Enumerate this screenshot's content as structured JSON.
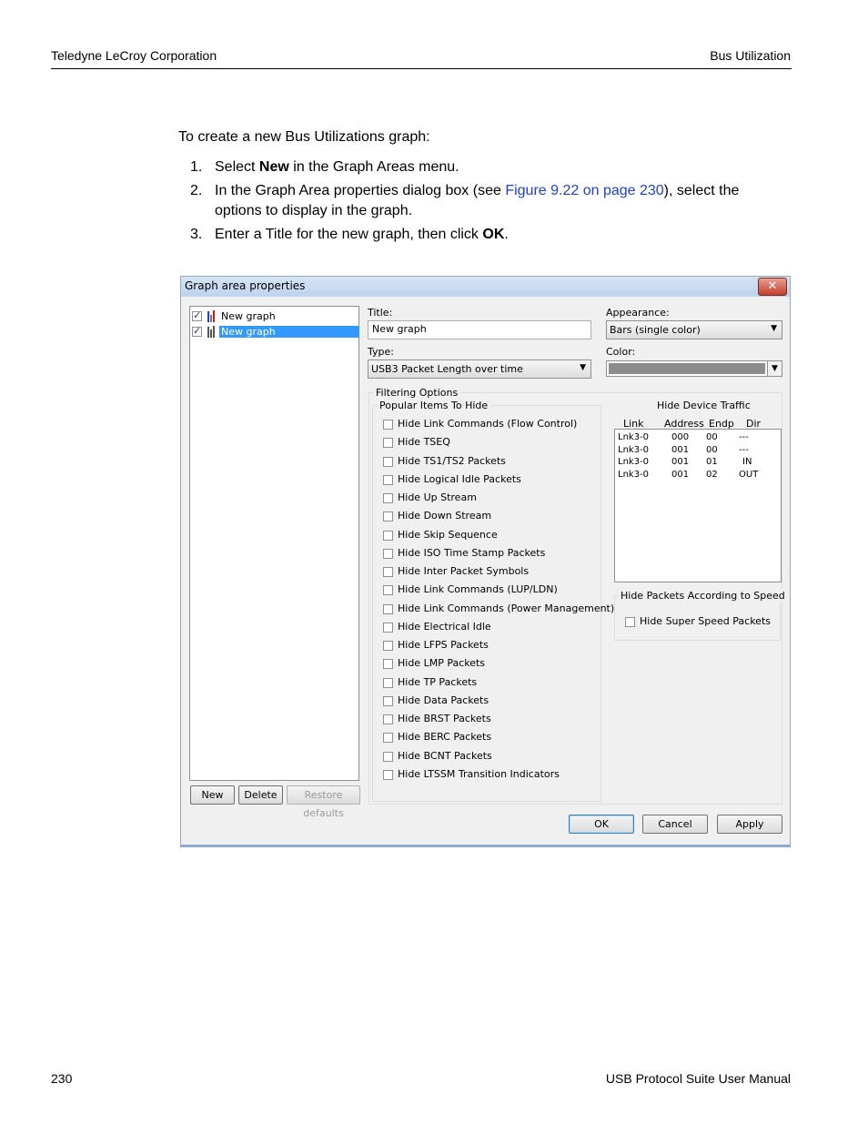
{
  "header": {
    "left": "Teledyne LeCroy Corporation",
    "right": "Bus Utilization"
  },
  "intro": "To create a new Bus Utilizations graph:",
  "steps": [
    {
      "num": "1.",
      "pre": "Select ",
      "bold": "New",
      "post": " in the Graph Areas menu."
    },
    {
      "num": "2.",
      "pre": "In the Graph Area properties dialog box (see ",
      "link": "Figure 9.22 on page 230",
      "post": "), select the options to display in the graph."
    },
    {
      "num": "3.",
      "pre": "Enter a Title for the new graph, then click ",
      "bold": "OK",
      "post": "."
    }
  ],
  "footer": {
    "left": "230",
    "right": "USB Protocol Suite User Manual"
  },
  "dialog": {
    "title": "Graph area properties",
    "close_glyph": "✕",
    "tree": [
      {
        "label": "New graph",
        "checked": true,
        "selected": false
      },
      {
        "label": "New graph",
        "checked": true,
        "selected": true
      }
    ],
    "buttons": {
      "new": "New",
      "delete": "Delete",
      "restore": "Restore defaults",
      "ok": "OK",
      "cancel": "Cancel",
      "apply": "Apply"
    },
    "title_label": "Title:",
    "title_value": "New graph",
    "type_label": "Type:",
    "type_value": "USB3 Packet Length over time",
    "appearance_label": "Appearance:",
    "appearance_value": "Bars (single color)",
    "color_label": "Color:",
    "color_value": "#8c8c8c",
    "filtering_title": "Filtering Options",
    "popular_title": "Popular Items To Hide",
    "popular_items": [
      "Hide Link Commands (Flow Control)",
      "Hide TSEQ",
      "Hide TS1/TS2 Packets",
      "Hide Logical Idle Packets",
      "Hide Up Stream",
      "Hide Down Stream",
      "Hide Skip Sequence",
      "Hide ISO Time Stamp Packets",
      "Hide Inter Packet Symbols",
      "Hide Link Commands (LUP/LDN)",
      "Hide Link Commands (Power Management)",
      "Hide Electrical Idle",
      "Hide LFPS Packets",
      "Hide LMP Packets",
      "Hide TP Packets",
      "Hide Data Packets",
      "Hide BRST Packets",
      "Hide BERC Packets",
      "Hide BCNT Packets",
      "Hide LTSSM Transition Indicators"
    ],
    "device_title": "Hide Device Traffic",
    "device_columns": [
      "Link",
      "Address",
      "Endp",
      "Dir"
    ],
    "device_rows": [
      [
        "Lnk3-0",
        "000",
        "00",
        "---"
      ],
      [
        "Lnk3-0",
        "001",
        "00",
        "---"
      ],
      [
        "Lnk3-0",
        "001",
        "01",
        "IN"
      ],
      [
        "Lnk3-0",
        "001",
        "02",
        "OUT"
      ]
    ],
    "speed_title": "Hide Packets According to Speed",
    "speed_item": "Hide Super Speed Packets"
  }
}
